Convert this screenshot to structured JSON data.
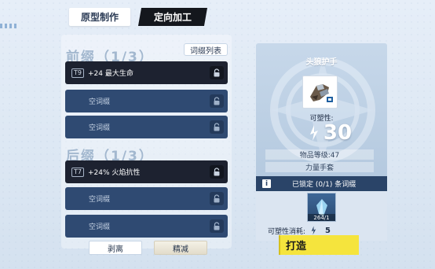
{
  "tabs": [
    {
      "label": "原型制作",
      "active": true
    },
    {
      "label": "定向加工",
      "active": false
    }
  ],
  "affix_list_button": "词缀列表",
  "prefix": {
    "title": "前缀（1/3）",
    "slots": [
      {
        "tier": "T9",
        "stat": "+24 最大生命",
        "empty": false
      },
      {
        "text": "空词缀",
        "empty": true
      },
      {
        "text": "空词缀",
        "empty": true
      }
    ]
  },
  "suffix": {
    "title": "后缀（1/3）",
    "slots": [
      {
        "tier": "T7",
        "stat": "+24% 火焰抗性",
        "empty": false
      },
      {
        "text": "空词缀",
        "empty": true
      },
      {
        "text": "空词缀",
        "empty": true
      }
    ]
  },
  "buttons": {
    "strip": "剥离",
    "refine": "精减",
    "forge": "打造"
  },
  "item": {
    "name": "头狼护手",
    "malleable_label": "可塑性:",
    "malleable_value": "30",
    "level_text": "物品等级:47",
    "type_text": "力量手套"
  },
  "lock": {
    "status": "已锁定 (0/1) 条词缀",
    "material_count": "264/1",
    "cost_label": "可塑性消耗:",
    "cost_value": "5"
  },
  "colors": {
    "accent_yellow": "#f5e43d",
    "slot_dark": "#1d2230",
    "slot_empty": "#2f4a72"
  }
}
